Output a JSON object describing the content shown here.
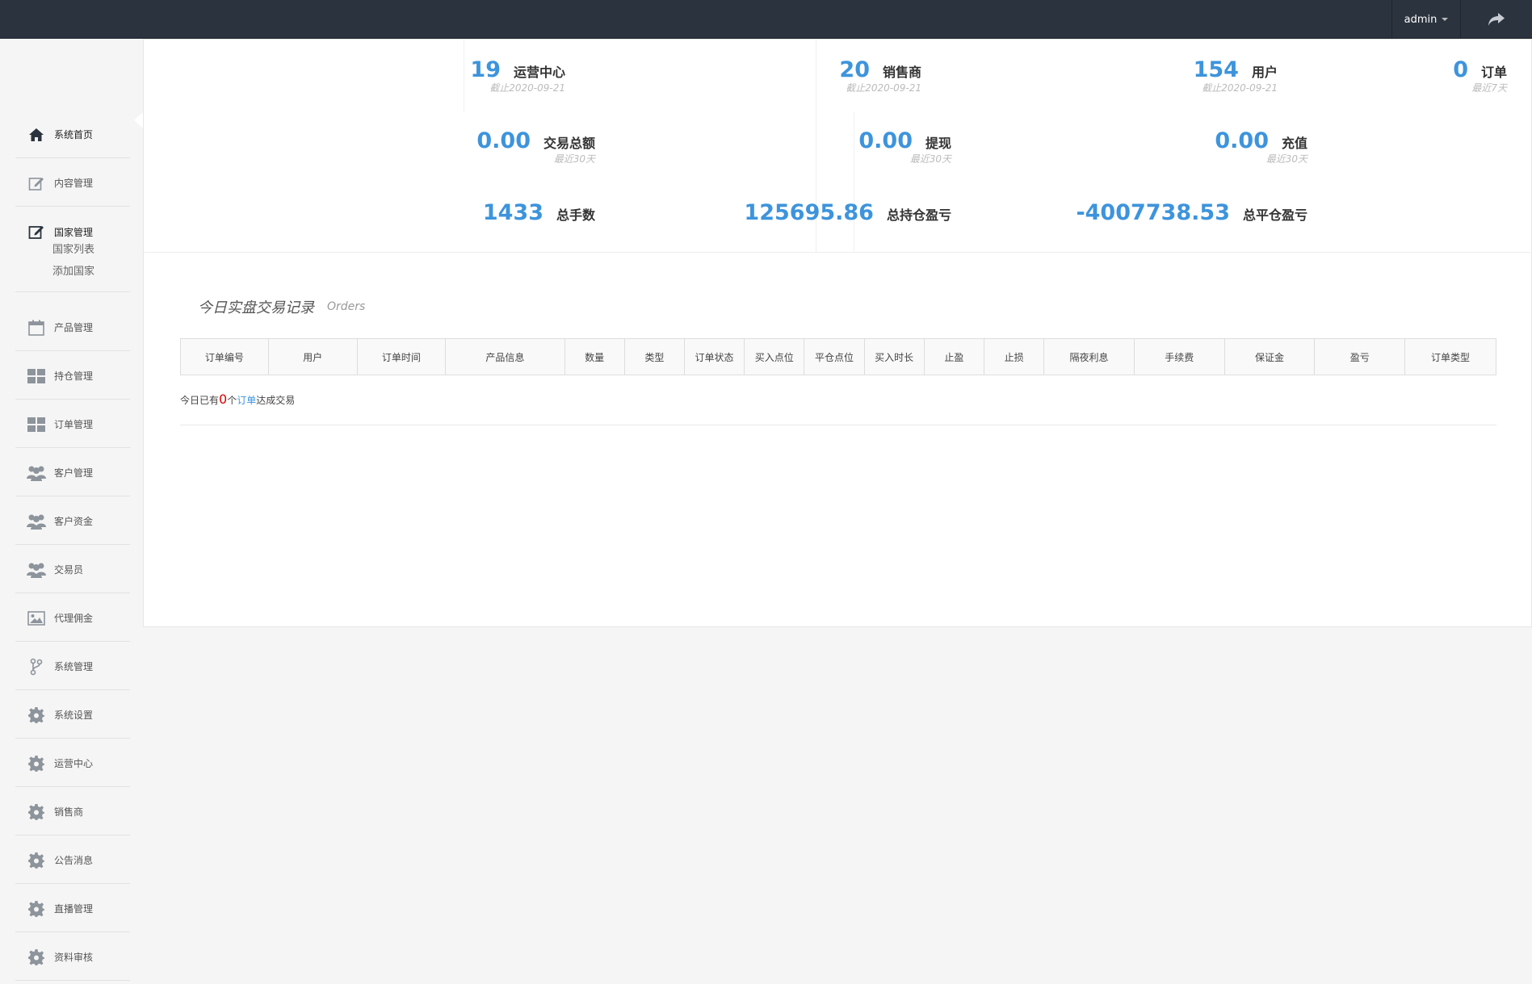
{
  "topbar": {
    "user": "admin"
  },
  "sidebar": {
    "items": [
      {
        "label": "系统首页",
        "icon": "home-icon"
      },
      {
        "label": "内容管理",
        "icon": "edit-icon"
      },
      {
        "label": "国家管理",
        "icon": "edit-icon"
      },
      {
        "label": "产品管理",
        "icon": "calendar-icon"
      },
      {
        "label": "持仓管理",
        "icon": "grid-icon"
      },
      {
        "label": "订单管理",
        "icon": "grid-icon"
      },
      {
        "label": "客户管理",
        "icon": "users-icon"
      },
      {
        "label": "客户资金",
        "icon": "users-icon"
      },
      {
        "label": "交易员",
        "icon": "users-icon"
      },
      {
        "label": "代理佣金",
        "icon": "image-icon"
      },
      {
        "label": "系统管理",
        "icon": "branch-icon"
      },
      {
        "label": "系统设置",
        "icon": "gear-icon"
      },
      {
        "label": "运营中心",
        "icon": "gear-icon"
      },
      {
        "label": "销售商",
        "icon": "gear-icon"
      },
      {
        "label": "公告消息",
        "icon": "gear-icon"
      },
      {
        "label": "直播管理",
        "icon": "gear-icon"
      },
      {
        "label": "资料审核",
        "icon": "gear-icon"
      }
    ],
    "subitems": [
      "国家列表",
      "添加国家"
    ]
  },
  "stats": {
    "operation_center": {
      "value": "19",
      "label": "运营中心",
      "sub": "截止2020-09-21"
    },
    "distributors": {
      "value": "20",
      "label": "销售商",
      "sub": "截止2020-09-21"
    },
    "users": {
      "value": "154",
      "label": "用户",
      "sub": "截止2020-09-21"
    },
    "orders": {
      "value": "0",
      "label": "订单",
      "sub": "最近7天"
    },
    "trade_total": {
      "value": "0.00",
      "label": "交易总额",
      "sub": "最近30天"
    },
    "withdraw": {
      "value": "0.00",
      "label": "提现",
      "sub": "最近30天"
    },
    "recharge": {
      "value": "0.00",
      "label": "充值",
      "sub": "最近30天"
    },
    "total_lots": {
      "value": "1433",
      "label": "总手数"
    },
    "total_position_pl": {
      "value": "125695.86",
      "label": "总持仓盈亏"
    },
    "total_close_pl": {
      "value": "-4007738.53",
      "label": "总平仓盈亏"
    }
  },
  "orders_section": {
    "title": "今日实盘交易记录",
    "subtitle": "Orders",
    "columns": [
      "订单编号",
      "用户",
      "订单时间",
      "产品信息",
      "数量",
      "类型",
      "订单状态",
      "买入点位",
      "平仓点位",
      "买入时长",
      "止盈",
      "止损",
      "隔夜利息",
      "手续费",
      "保证金",
      "盈亏",
      "订单类型"
    ],
    "summary_prefix": "今日已有",
    "summary_count": "0",
    "summary_mid": "个",
    "summary_link": "订单",
    "summary_suffix": "达成交易"
  },
  "colors": {
    "accent": "#3d94dc",
    "topbar": "#2b333e",
    "negative_count": "#dd0000"
  }
}
